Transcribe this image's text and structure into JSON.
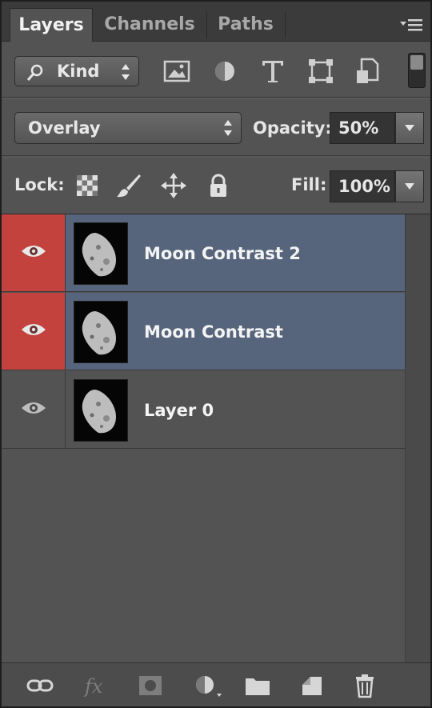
{
  "tabs": [
    "Layers",
    "Channels",
    "Paths"
  ],
  "filter": {
    "kind_label": "Kind",
    "icons": [
      "image-filter-icon",
      "adjustment-filter-icon",
      "type-filter-icon",
      "shape-filter-icon",
      "smart-object-filter-icon",
      "filter-toggle"
    ]
  },
  "blend": {
    "mode": "Overlay",
    "opacity_label": "Opacity:",
    "opacity_value": "50%",
    "fill_label": "Fill:",
    "fill_value": "100%"
  },
  "lock": {
    "label": "Lock:",
    "icons": [
      "lock-transparent-pixels-icon",
      "lock-image-pixels-icon",
      "lock-position-icon",
      "lock-all-icon"
    ]
  },
  "layers": [
    {
      "name": "Moon Contrast 2",
      "selected": true
    },
    {
      "name": "Moon Contrast",
      "selected": true
    },
    {
      "name": "Layer 0",
      "selected": false
    }
  ],
  "bottom_icons": [
    "link-layers-icon",
    "fx-icon",
    "add-mask-icon",
    "adjustment-layer-icon",
    "new-group-icon",
    "new-layer-icon",
    "trash-icon"
  ],
  "colors": {
    "panel_bg": "#535353",
    "selected_layer": "#56657c",
    "visibility_highlight": "#c4423d"
  }
}
